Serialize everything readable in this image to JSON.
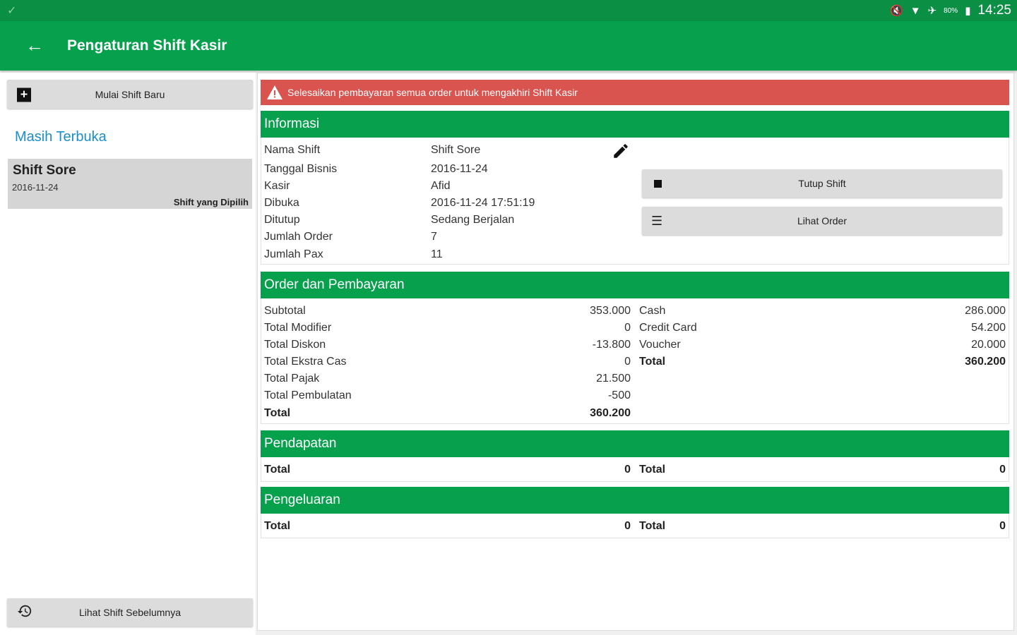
{
  "status_bar": {
    "time": "14:25",
    "battery": "80%"
  },
  "app_bar": {
    "title": "Pengaturan Shift Kasir"
  },
  "sidebar": {
    "new_shift_label": "Mulai Shift Baru",
    "open_section_title": "Masih Terbuka",
    "open_shifts": [
      {
        "name": "Shift Sore",
        "date": "2016-11-24",
        "selected_label": "Shift yang Dipilih"
      }
    ],
    "previous_shifts_label": "Lihat Shift Sebelumnya"
  },
  "alert": {
    "text": "Selesaikan pembayaran semua order untuk mengakhiri Shift Kasir"
  },
  "informasi": {
    "title": "Informasi",
    "rows": [
      {
        "label": "Nama Shift",
        "value": "Shift Sore"
      },
      {
        "label": "Tanggal Bisnis",
        "value": "2016-11-24"
      },
      {
        "label": "Kasir",
        "value": "Afid"
      },
      {
        "label": "Dibuka",
        "value": "2016-11-24 17:51:19"
      },
      {
        "label": "Ditutup",
        "value": "Sedang Berjalan"
      },
      {
        "label": "Jumlah Order",
        "value": "7"
      },
      {
        "label": "Jumlah Pax",
        "value": "11"
      }
    ],
    "close_shift_label": "Tutup Shift",
    "view_orders_label": "Lihat Order"
  },
  "order_pembayaran": {
    "title": "Order dan Pembayaran",
    "left": [
      {
        "label": "Subtotal",
        "value": "353.000"
      },
      {
        "label": "Total Modifier",
        "value": "0"
      },
      {
        "label": "Total Diskon",
        "value": "-13.800"
      },
      {
        "label": "Total Ekstra Cas",
        "value": "0"
      },
      {
        "label": "Total Pajak",
        "value": "21.500"
      },
      {
        "label": "Total Pembulatan",
        "value": "-500"
      },
      {
        "label": "Total",
        "value": "360.200"
      }
    ],
    "right": [
      {
        "label": "Cash",
        "value": "286.000"
      },
      {
        "label": "Credit Card",
        "value": "54.200"
      },
      {
        "label": "Voucher",
        "value": "20.000"
      },
      {
        "label": "Total",
        "value": "360.200"
      }
    ]
  },
  "pendapatan": {
    "title": "Pendapatan",
    "left": {
      "label": "Total",
      "value": "0"
    },
    "right": {
      "label": "Total",
      "value": "0"
    }
  },
  "pengeluaran": {
    "title": "Pengeluaran",
    "left": {
      "label": "Total",
      "value": "0"
    },
    "right": {
      "label": "Total",
      "value": "0"
    }
  },
  "colors": {
    "primary": "#07a04c",
    "status_bar": "#0a8f44",
    "alert": "#d9534f",
    "link": "#1a8fc9"
  }
}
